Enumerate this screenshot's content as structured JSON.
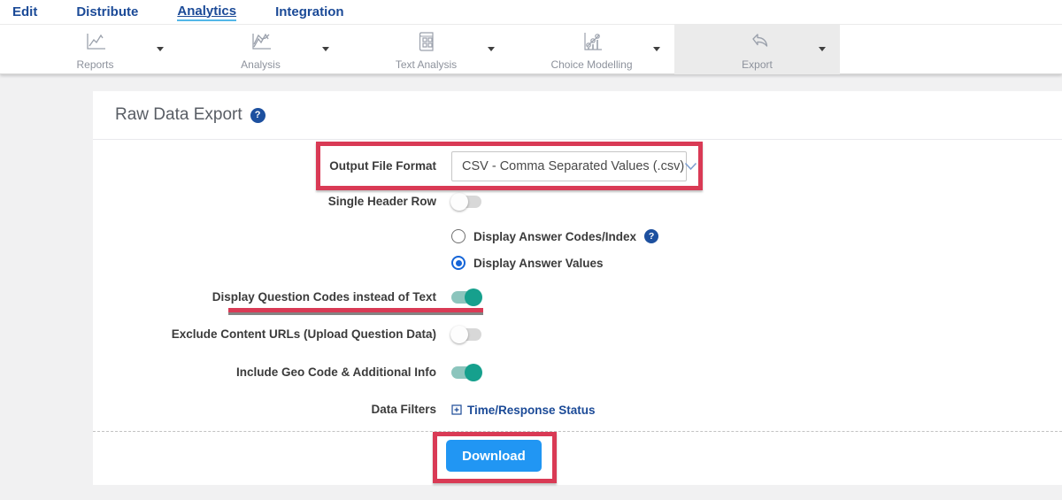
{
  "nav": {
    "items": [
      {
        "label": "Edit"
      },
      {
        "label": "Distribute"
      },
      {
        "label": "Analytics",
        "active": true
      },
      {
        "label": "Integration"
      }
    ]
  },
  "toolbar": {
    "tabs": [
      {
        "label": "Reports",
        "icon": "reports-line-chart-icon"
      },
      {
        "label": "Analysis",
        "icon": "analysis-multiline-chart-icon"
      },
      {
        "label": "Text Analysis",
        "icon": "text-analysis-document-icon"
      },
      {
        "label": "Choice Modelling",
        "icon": "choice-modelling-chart-icon"
      },
      {
        "label": "Export",
        "icon": "export-arrow-icon",
        "active": true
      }
    ]
  },
  "main": {
    "title": "Raw Data Export",
    "form": {
      "output_format": {
        "label": "Output File Format",
        "value": "CSV - Comma Separated Values (.csv)"
      },
      "single_header": {
        "label": "Single Header Row",
        "state": "off"
      },
      "answer_display": {
        "options": [
          {
            "label": "Display Answer Codes/Index",
            "selected": false,
            "has_help": true
          },
          {
            "label": "Display Answer Values",
            "selected": true
          }
        ]
      },
      "question_codes": {
        "label": "Display Question Codes instead of Text",
        "state": "on"
      },
      "exclude_urls": {
        "label": "Exclude Content URLs (Upload Question Data)",
        "state": "off"
      },
      "geo_code": {
        "label": "Include Geo Code & Additional Info",
        "state": "on"
      },
      "data_filters": {
        "label": "Data Filters",
        "link": "Time/Response Status"
      },
      "download": {
        "label": "Download"
      }
    }
  },
  "colors": {
    "nav_blue": "#1b4a97",
    "toggle_on_teal": "#16a08d",
    "download_blue": "#2196f3",
    "annotation_red": "#d93a55",
    "help_badge_blue": "#1d509f",
    "radio_blue": "#1565d8",
    "active_tab_gray": "#ebebeb"
  }
}
